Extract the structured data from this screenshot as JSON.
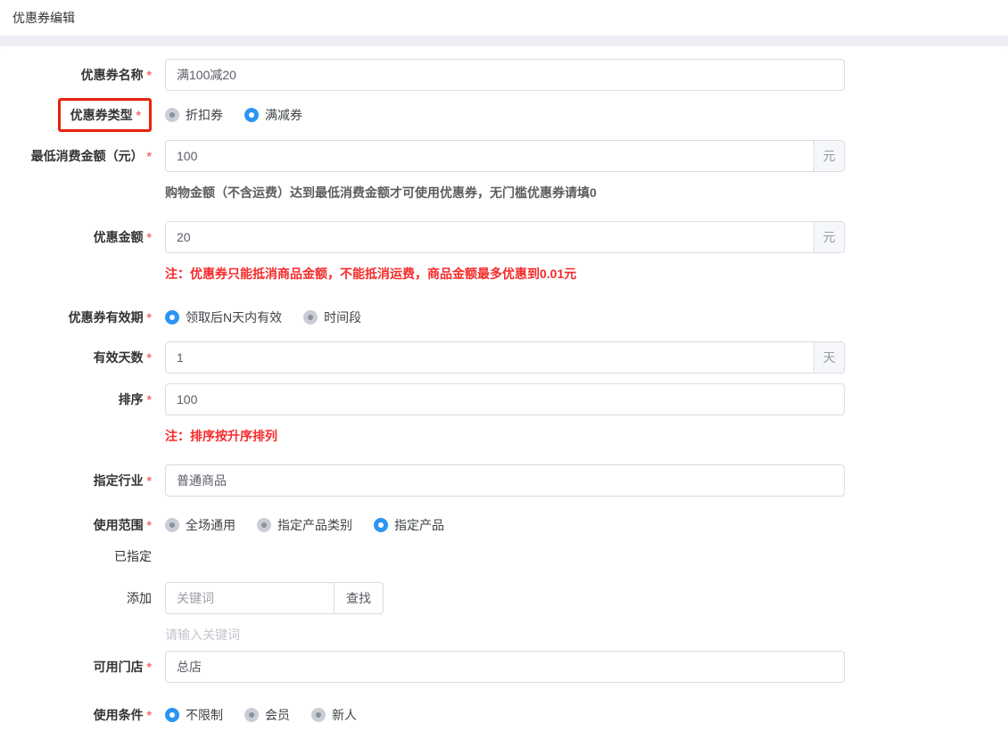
{
  "page": {
    "title": "优惠券编辑"
  },
  "meta": {
    "accent_blue": "#2b95f3",
    "annotation_red": "#e8220e",
    "note_red": "#f52b2b",
    "required_mark": "*"
  },
  "form": {
    "rows": [
      {
        "id": "coupon-name",
        "label": "优惠券名称",
        "required": true,
        "value": "满100减20"
      },
      {
        "id": "coupon-type",
        "label": "优惠券类型",
        "required": true,
        "annotated": true,
        "options": [
          {
            "label": "折扣券",
            "checked": false
          },
          {
            "label": "满减券",
            "checked": true
          }
        ]
      },
      {
        "id": "min-spend",
        "label": "最低消费金额（元）",
        "required": true,
        "value": "100",
        "suffix": "元",
        "help": "购物金额（不含运费）达到最低消费金额才可使用优惠券，无门槛优惠券请填0"
      },
      {
        "id": "discount-amount",
        "label": "优惠金额",
        "required": true,
        "value": "20",
        "suffix": "元",
        "note": "注：优惠券只能抵消商品金额，不能抵消运费，商品金额最多优惠到0.01元"
      },
      {
        "id": "validity-type",
        "label": "优惠券有效期",
        "required": true,
        "options": [
          {
            "label": "领取后N天内有效",
            "checked": true
          },
          {
            "label": "时间段",
            "checked": false
          }
        ]
      },
      {
        "id": "valid-days",
        "label": "有效天数",
        "required": true,
        "value": "1",
        "suffix": "天"
      },
      {
        "id": "sort-order",
        "label": "排序",
        "required": true,
        "value": "100",
        "note": "注：排序按升序排列"
      },
      {
        "id": "industry",
        "label": "指定行业",
        "required": true,
        "value": "普通商品"
      },
      {
        "id": "usage-scope",
        "label": "使用范围",
        "required": true,
        "options": [
          {
            "label": "全场通用",
            "checked": false
          },
          {
            "label": "指定产品类别",
            "checked": false
          },
          {
            "label": "指定产品",
            "checked": true
          }
        ]
      },
      {
        "id": "assigned",
        "label": "已指定",
        "required": false
      },
      {
        "id": "add-keyword",
        "label": "添加",
        "required": false,
        "placeholder": "关键词",
        "button": "查找",
        "hint": "请输入关键词"
      },
      {
        "id": "available-store",
        "label": "可用门店",
        "required": true,
        "value": "总店"
      },
      {
        "id": "usage-condition",
        "label": "使用条件",
        "required": true,
        "options": [
          {
            "label": "不限制",
            "checked": true
          },
          {
            "label": "会员",
            "checked": false
          },
          {
            "label": "新人",
            "checked": false
          }
        ]
      }
    ]
  }
}
